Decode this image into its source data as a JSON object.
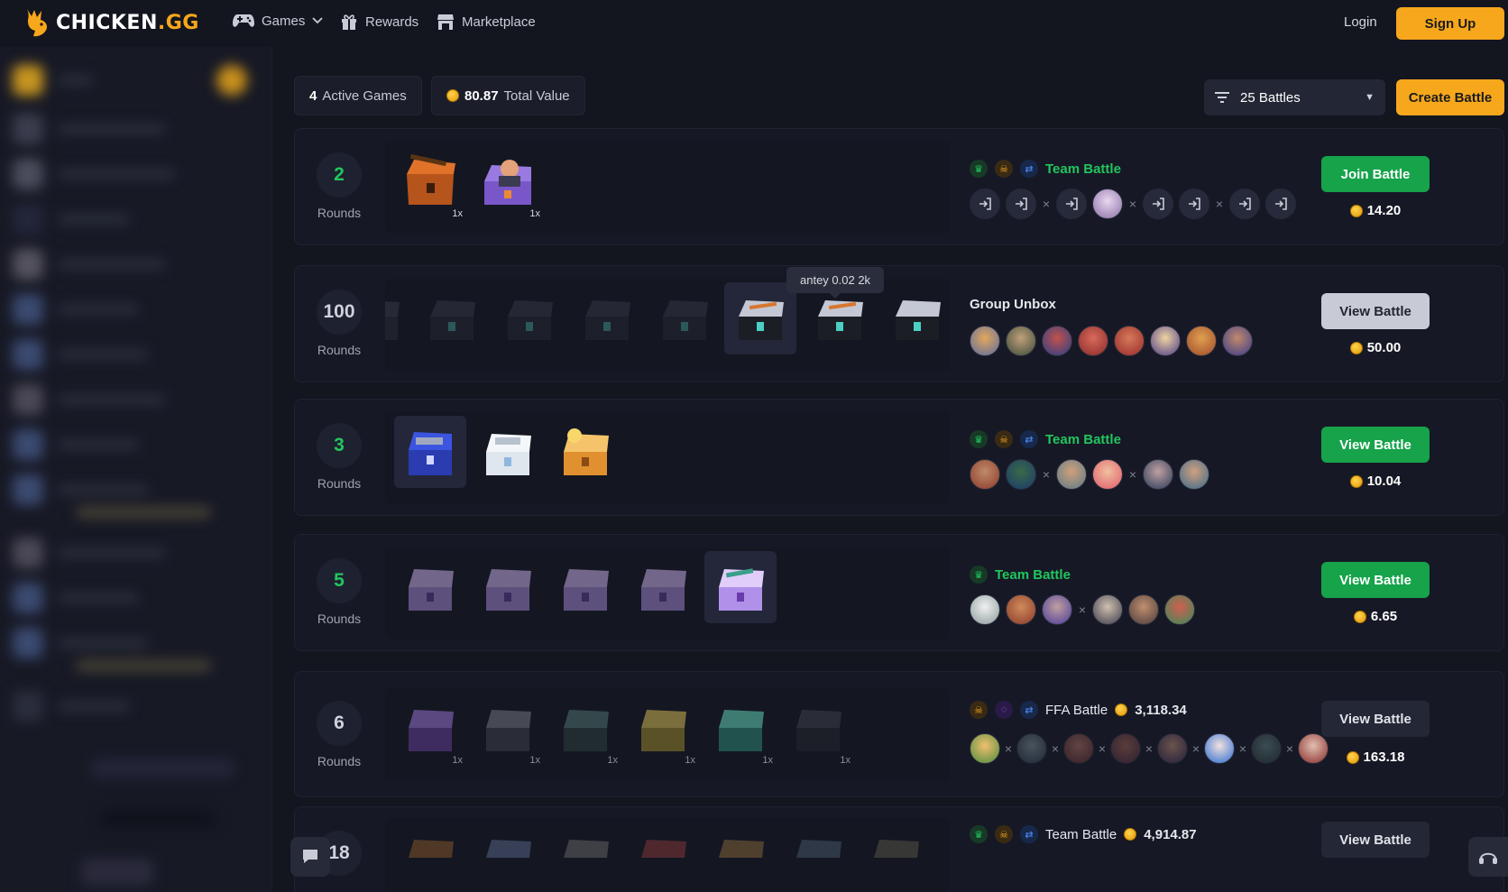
{
  "nav": {
    "brand_main": "CHICKEN",
    "brand_suffix": ".GG",
    "games": "Games",
    "rewards": "Rewards",
    "marketplace": "Marketplace",
    "login": "Login",
    "signup": "Sign Up"
  },
  "summary": {
    "active_count": "4",
    "active_label": "Active Games",
    "total_value": "80.87",
    "total_label": "Total Value"
  },
  "filter": {
    "selected": "25 Battles"
  },
  "create_label": "Create Battle",
  "tooltip": "antey 0.02 2k",
  "rounds_label": "Rounds",
  "battles": [
    {
      "rounds": "2",
      "mode": "Team Battle",
      "action": "Join Battle",
      "price": "14.20",
      "header_value": ""
    },
    {
      "rounds": "100",
      "mode": "Group Unbox",
      "action": "View Battle",
      "price": "50.00",
      "header_value": ""
    },
    {
      "rounds": "3",
      "mode": "Team Battle",
      "action": "View Battle",
      "price": "10.04",
      "header_value": ""
    },
    {
      "rounds": "5",
      "mode": "Team Battle",
      "action": "View Battle",
      "price": "6.65",
      "header_value": ""
    },
    {
      "rounds": "6",
      "mode": "FFA Battle",
      "action": "View Battle",
      "price": "163.18",
      "header_value": "3,118.34"
    },
    {
      "rounds": "18",
      "mode": "Team Battle",
      "action": "View Battle",
      "price": "",
      "header_value": "4,914.87"
    }
  ],
  "case_qty": "1x",
  "colors": {
    "accent": "#f6a71c",
    "green": "#22c55e",
    "background": "#13151f",
    "card": "#161925"
  }
}
